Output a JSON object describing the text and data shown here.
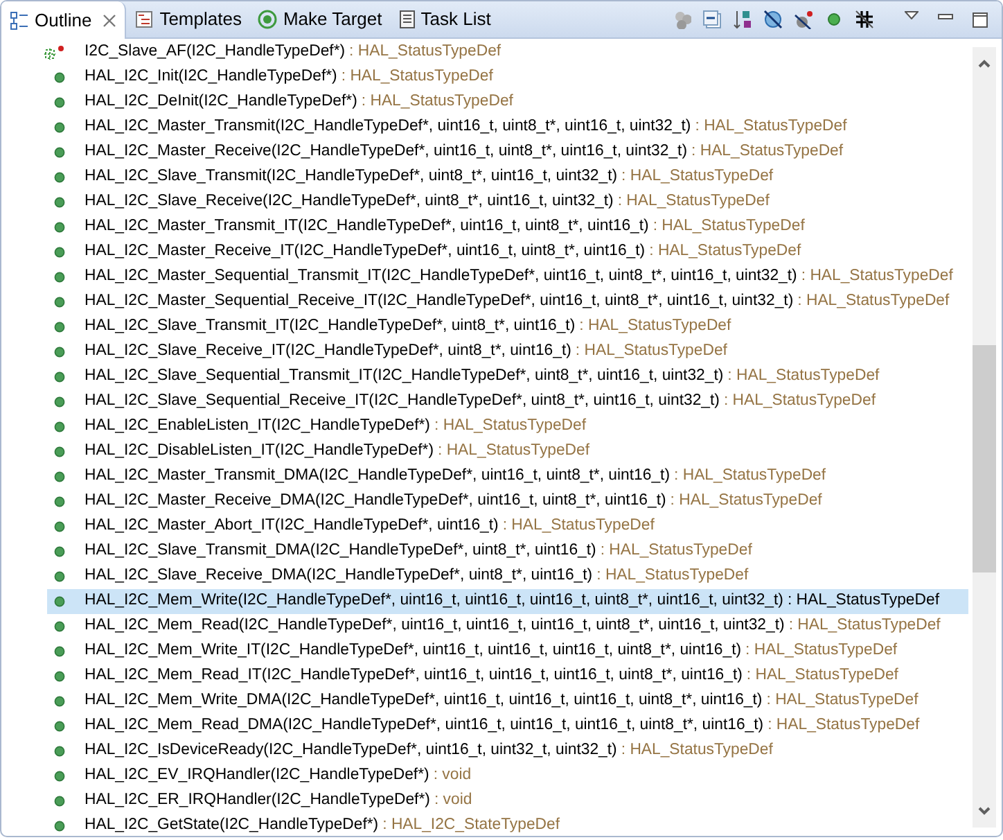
{
  "tabs": [
    {
      "label": "Outline",
      "selected": true,
      "closable": true
    },
    {
      "label": "Templates",
      "selected": false,
      "closable": false
    },
    {
      "label": "Make Target",
      "selected": false,
      "closable": false
    },
    {
      "label": "Task List",
      "selected": false,
      "closable": false
    }
  ],
  "items": [
    {
      "kind": "static",
      "signature": "I2C_Slave_AF(I2C_HandleTypeDef*)",
      "return_type": ": HAL_StatusTypeDef",
      "selected": false
    },
    {
      "kind": "function",
      "signature": "HAL_I2C_Init(I2C_HandleTypeDef*)",
      "return_type": ": HAL_StatusTypeDef",
      "selected": false
    },
    {
      "kind": "function",
      "signature": "HAL_I2C_DeInit(I2C_HandleTypeDef*)",
      "return_type": ": HAL_StatusTypeDef",
      "selected": false
    },
    {
      "kind": "function",
      "signature": "HAL_I2C_Master_Transmit(I2C_HandleTypeDef*, uint16_t, uint8_t*, uint16_t, uint32_t)",
      "return_type": ": HAL_StatusTypeDef",
      "selected": false
    },
    {
      "kind": "function",
      "signature": "HAL_I2C_Master_Receive(I2C_HandleTypeDef*, uint16_t, uint8_t*, uint16_t, uint32_t)",
      "return_type": ": HAL_StatusTypeDef",
      "selected": false
    },
    {
      "kind": "function",
      "signature": "HAL_I2C_Slave_Transmit(I2C_HandleTypeDef*, uint8_t*, uint16_t, uint32_t)",
      "return_type": ": HAL_StatusTypeDef",
      "selected": false
    },
    {
      "kind": "function",
      "signature": "HAL_I2C_Slave_Receive(I2C_HandleTypeDef*, uint8_t*, uint16_t, uint32_t)",
      "return_type": ": HAL_StatusTypeDef",
      "selected": false
    },
    {
      "kind": "function",
      "signature": "HAL_I2C_Master_Transmit_IT(I2C_HandleTypeDef*, uint16_t, uint8_t*, uint16_t)",
      "return_type": ": HAL_StatusTypeDef",
      "selected": false
    },
    {
      "kind": "function",
      "signature": "HAL_I2C_Master_Receive_IT(I2C_HandleTypeDef*, uint16_t, uint8_t*, uint16_t)",
      "return_type": ": HAL_StatusTypeDef",
      "selected": false
    },
    {
      "kind": "function",
      "signature": "HAL_I2C_Master_Sequential_Transmit_IT(I2C_HandleTypeDef*, uint16_t, uint8_t*, uint16_t, uint32_t)",
      "return_type": ": HAL_StatusTypeDef",
      "selected": false
    },
    {
      "kind": "function",
      "signature": "HAL_I2C_Master_Sequential_Receive_IT(I2C_HandleTypeDef*, uint16_t, uint8_t*, uint16_t, uint32_t)",
      "return_type": ": HAL_StatusTypeDef",
      "selected": false
    },
    {
      "kind": "function",
      "signature": "HAL_I2C_Slave_Transmit_IT(I2C_HandleTypeDef*, uint8_t*, uint16_t)",
      "return_type": ": HAL_StatusTypeDef",
      "selected": false
    },
    {
      "kind": "function",
      "signature": "HAL_I2C_Slave_Receive_IT(I2C_HandleTypeDef*, uint8_t*, uint16_t)",
      "return_type": ": HAL_StatusTypeDef",
      "selected": false
    },
    {
      "kind": "function",
      "signature": "HAL_I2C_Slave_Sequential_Transmit_IT(I2C_HandleTypeDef*, uint8_t*, uint16_t, uint32_t)",
      "return_type": ": HAL_StatusTypeDef",
      "selected": false
    },
    {
      "kind": "function",
      "signature": "HAL_I2C_Slave_Sequential_Receive_IT(I2C_HandleTypeDef*, uint8_t*, uint16_t, uint32_t)",
      "return_type": ": HAL_StatusTypeDef",
      "selected": false
    },
    {
      "kind": "function",
      "signature": "HAL_I2C_EnableListen_IT(I2C_HandleTypeDef*)",
      "return_type": ": HAL_StatusTypeDef",
      "selected": false
    },
    {
      "kind": "function",
      "signature": "HAL_I2C_DisableListen_IT(I2C_HandleTypeDef*)",
      "return_type": ": HAL_StatusTypeDef",
      "selected": false
    },
    {
      "kind": "function",
      "signature": "HAL_I2C_Master_Transmit_DMA(I2C_HandleTypeDef*, uint16_t, uint8_t*, uint16_t)",
      "return_type": ": HAL_StatusTypeDef",
      "selected": false
    },
    {
      "kind": "function",
      "signature": "HAL_I2C_Master_Receive_DMA(I2C_HandleTypeDef*, uint16_t, uint8_t*, uint16_t)",
      "return_type": ": HAL_StatusTypeDef",
      "selected": false
    },
    {
      "kind": "function",
      "signature": "HAL_I2C_Master_Abort_IT(I2C_HandleTypeDef*, uint16_t)",
      "return_type": ": HAL_StatusTypeDef",
      "selected": false
    },
    {
      "kind": "function",
      "signature": "HAL_I2C_Slave_Transmit_DMA(I2C_HandleTypeDef*, uint8_t*, uint16_t)",
      "return_type": ": HAL_StatusTypeDef",
      "selected": false
    },
    {
      "kind": "function",
      "signature": "HAL_I2C_Slave_Receive_DMA(I2C_HandleTypeDef*, uint8_t*, uint16_t)",
      "return_type": ": HAL_StatusTypeDef",
      "selected": false
    },
    {
      "kind": "function",
      "signature": "HAL_I2C_Mem_Write(I2C_HandleTypeDef*, uint16_t, uint16_t, uint16_t, uint8_t*, uint16_t, uint32_t)",
      "return_type": ": HAL_StatusTypeDef",
      "selected": true
    },
    {
      "kind": "function",
      "signature": "HAL_I2C_Mem_Read(I2C_HandleTypeDef*, uint16_t, uint16_t, uint16_t, uint8_t*, uint16_t, uint32_t)",
      "return_type": ": HAL_StatusTypeDef",
      "selected": false
    },
    {
      "kind": "function",
      "signature": "HAL_I2C_Mem_Write_IT(I2C_HandleTypeDef*, uint16_t, uint16_t, uint16_t, uint8_t*, uint16_t)",
      "return_type": ": HAL_StatusTypeDef",
      "selected": false
    },
    {
      "kind": "function",
      "signature": "HAL_I2C_Mem_Read_IT(I2C_HandleTypeDef*, uint16_t, uint16_t, uint16_t, uint8_t*, uint16_t)",
      "return_type": ": HAL_StatusTypeDef",
      "selected": false
    },
    {
      "kind": "function",
      "signature": "HAL_I2C_Mem_Write_DMA(I2C_HandleTypeDef*, uint16_t, uint16_t, uint16_t, uint8_t*, uint16_t)",
      "return_type": ": HAL_StatusTypeDef",
      "selected": false
    },
    {
      "kind": "function",
      "signature": "HAL_I2C_Mem_Read_DMA(I2C_HandleTypeDef*, uint16_t, uint16_t, uint16_t, uint8_t*, uint16_t)",
      "return_type": ": HAL_StatusTypeDef",
      "selected": false
    },
    {
      "kind": "function",
      "signature": "HAL_I2C_IsDeviceReady(I2C_HandleTypeDef*, uint16_t, uint32_t, uint32_t)",
      "return_type": ": HAL_StatusTypeDef",
      "selected": false
    },
    {
      "kind": "function",
      "signature": "HAL_I2C_EV_IRQHandler(I2C_HandleTypeDef*)",
      "return_type": ": void",
      "selected": false
    },
    {
      "kind": "function",
      "signature": "HAL_I2C_ER_IRQHandler(I2C_HandleTypeDef*)",
      "return_type": ": void",
      "selected": false
    },
    {
      "kind": "function",
      "signature": "HAL_I2C_GetState(I2C_HandleTypeDef*)",
      "return_type": ": HAL_I2C_StateTypeDef",
      "selected": false
    }
  ]
}
